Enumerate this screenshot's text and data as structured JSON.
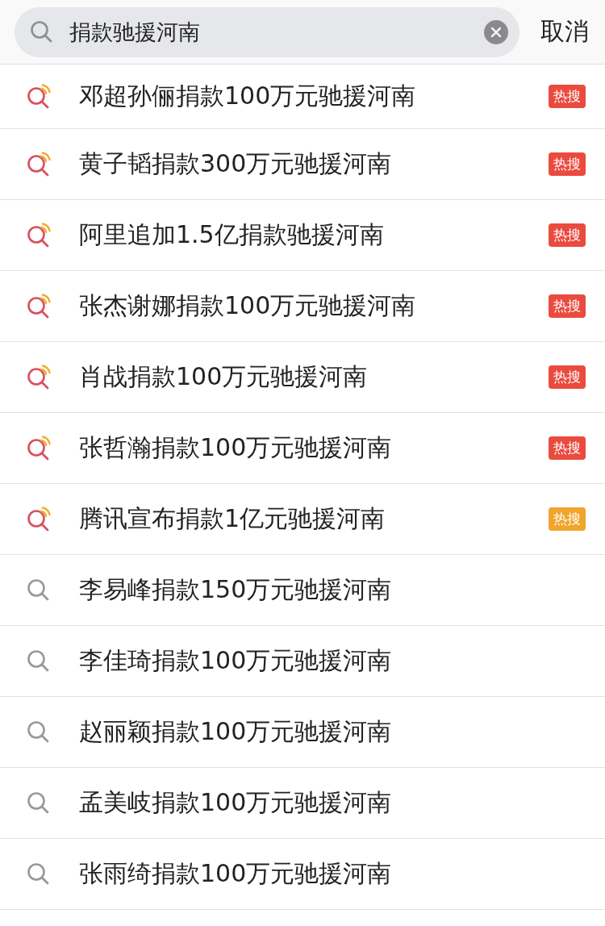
{
  "search": {
    "value": "捐款驰援河南",
    "cancel": "取消"
  },
  "suggestions": [
    {
      "kind": "hot",
      "text": "邓超孙俪捐款100万元驰援河南",
      "badge": {
        "text": "热搜",
        "color": "#ea4b3f"
      }
    },
    {
      "kind": "hot",
      "text": "黄子韬捐款300万元驰援河南",
      "badge": {
        "text": "热搜",
        "color": "#ea4b3f"
      }
    },
    {
      "kind": "hot",
      "text": "阿里追加1.5亿捐款驰援河南",
      "badge": {
        "text": "热搜",
        "color": "#ea4b3f"
      }
    },
    {
      "kind": "hot",
      "text": "张杰谢娜捐款100万元驰援河南",
      "badge": {
        "text": "热搜",
        "color": "#ea4b3f"
      }
    },
    {
      "kind": "hot",
      "text": "肖战捐款100万元驰援河南",
      "badge": {
        "text": "热搜",
        "color": "#ea4b3f"
      }
    },
    {
      "kind": "hot",
      "text": "张哲瀚捐款100万元驰援河南",
      "badge": {
        "text": "热搜",
        "color": "#ea4b3f"
      }
    },
    {
      "kind": "hot",
      "text": "腾讯宣布捐款1亿元驰援河南",
      "badge": {
        "text": "热搜",
        "color": "#f0a52c"
      }
    },
    {
      "kind": "plain",
      "text": "李易峰捐款150万元驰援河南"
    },
    {
      "kind": "plain",
      "text": "李佳琦捐款100万元驰援河南"
    },
    {
      "kind": "plain",
      "text": "赵丽颖捐款100万元驰援河南"
    },
    {
      "kind": "plain",
      "text": "孟美岐捐款100万元驰援河南"
    },
    {
      "kind": "plain",
      "text": "张雨绮捐款100万元驰援河南"
    }
  ]
}
